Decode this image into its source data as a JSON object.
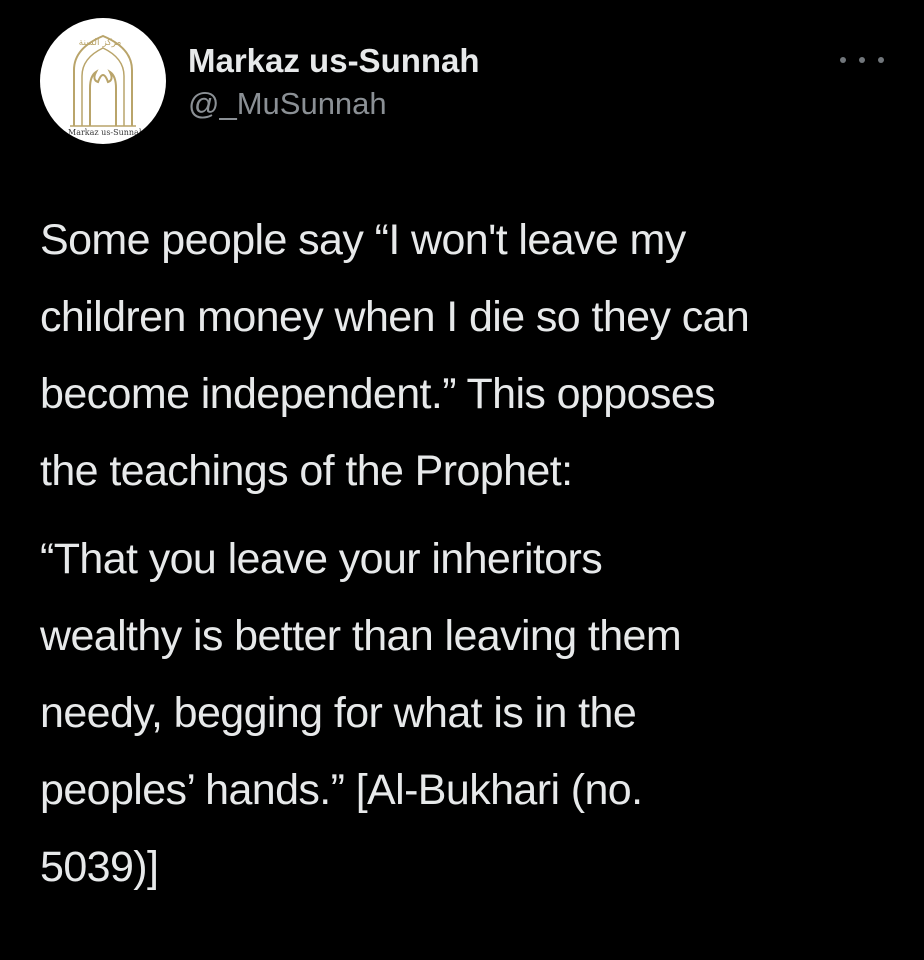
{
  "tweet": {
    "author": {
      "display_name": "Markaz us-Sunnah",
      "handle": "@_MuSunnah",
      "avatar": {
        "icon": "markaz-logo-icon",
        "arabic_text": "مركز السنة",
        "caption": "Markaz us-Sunnah",
        "colors": {
          "background": "#ffffff",
          "gold": "#b9a46a",
          "caption": "#3a3a3a"
        }
      }
    },
    "more_menu_icon": "more-options-icon",
    "paragraphs": [
      {
        "lines": [
          "Some people say “I won't leave my",
          "children money when I die so they can",
          "become independent.” This opposes",
          "the teachings of the Prophet:"
        ]
      },
      {
        "lines": [
          "“That you leave your inheritors",
          "wealthy is better than leaving them",
          "needy, begging for what is in the",
          "peoples’ hands.” [Al-Bukhari (no.",
          "5039)]"
        ]
      }
    ]
  },
  "colors": {
    "background": "#000000",
    "text_primary": "#e7e9ea",
    "text_secondary": "#8b9095",
    "icon_muted": "#71767b"
  }
}
